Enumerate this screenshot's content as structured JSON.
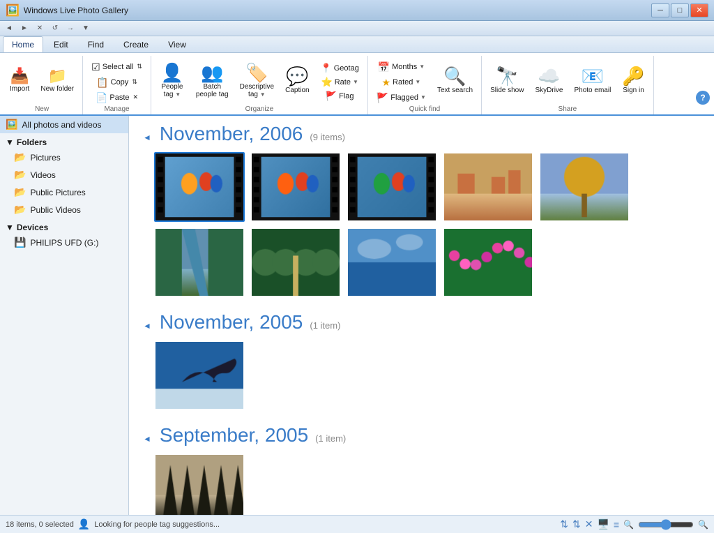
{
  "app": {
    "title": "Windows Live Photo Gallery",
    "help_btn": "?",
    "window_controls": {
      "minimize": "─",
      "maximize": "□",
      "close": "✕"
    }
  },
  "quick_bar": {
    "buttons": [
      "◄",
      "►",
      "✕",
      "↺",
      "→",
      "▼"
    ]
  },
  "ribbon": {
    "tabs": [
      "Home",
      "Edit",
      "Find",
      "Create",
      "View"
    ],
    "active_tab": "Home",
    "groups": {
      "new": {
        "label": "New",
        "import_label": "Import",
        "new_folder_label": "New folder"
      },
      "manage": {
        "label": "Manage",
        "select_all": "Select all",
        "copy": "Copy",
        "paste": "Paste"
      },
      "organize": {
        "label": "Organize",
        "people_tag": "People tag",
        "batch_people_tag": "Batch people tag",
        "descriptive_tag": "Descriptive tag",
        "caption": "Caption",
        "geotag": "Geotag",
        "rate": "Rate",
        "flag": "Flag"
      },
      "quick_find": {
        "label": "Quick find",
        "months": "Months",
        "rated": "Rated",
        "flagged": "Flagged",
        "text_search": "Text search"
      },
      "share": {
        "label": "Share",
        "slide_show": "Slide show",
        "skydrive": "SkyDrive",
        "photo_email": "Photo email",
        "sign_in": "Sign in"
      }
    }
  },
  "sidebar": {
    "all_label": "All photos and videos",
    "folders": {
      "header": "Folders",
      "items": [
        "Pictures",
        "Videos",
        "Public Pictures",
        "Public Videos"
      ]
    },
    "devices": {
      "header": "Devices",
      "items": [
        "PHILIPS UFD (G:)"
      ]
    }
  },
  "content": {
    "groups": [
      {
        "title": "November, 2006",
        "count": "(9 items)",
        "photo_count": 9
      },
      {
        "title": "November, 2005",
        "count": "(1 item)",
        "photo_count": 1
      },
      {
        "title": "September, 2005",
        "count": "(1 item)",
        "photo_count": 1
      }
    ]
  },
  "status_bar": {
    "items_count": "18 items, 0 selected",
    "people_tag_status": "Looking for people tag suggestions...",
    "zoom_level": 50
  }
}
